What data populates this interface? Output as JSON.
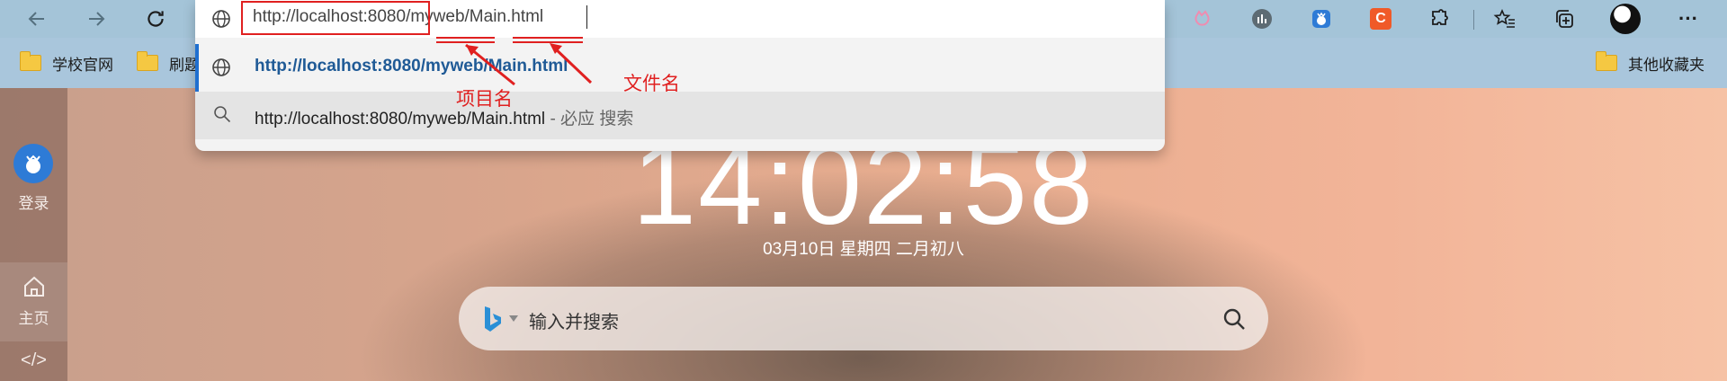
{
  "toolbar": {
    "back_icon": "arrow-left-icon",
    "forward_icon": "arrow-right-icon",
    "refresh_icon": "refresh-icon",
    "extension_icons": [
      "pink-extension-icon",
      "gray-extension-icon",
      "blue-bird-icon",
      "c-extension-icon",
      "puzzle-icon",
      "favorites-icon",
      "collections-icon",
      "profile-avatar",
      "more-icon"
    ],
    "c_extension_letter": "C",
    "more_label": "···"
  },
  "address_bar": {
    "url": "http://localhost:8080/myweb/Main.html"
  },
  "suggestions": [
    {
      "type": "url",
      "text": "http://localhost:8080/myweb/Main.html"
    },
    {
      "type": "search",
      "text": "http://localhost:8080/myweb/Main.html",
      "suffix": " - 必应 搜索"
    }
  ],
  "bookmarks": {
    "items": [
      "学校官网",
      "刷题"
    ],
    "other": "其他收藏夹"
  },
  "annotations": {
    "project_name": "项目名",
    "file_name": "文件名"
  },
  "page": {
    "time": "14:02:58",
    "date": "03月10日 星期四 二月初八",
    "search_placeholder": "输入并搜索",
    "login_label": "登录",
    "home_label": "主页",
    "code_label": "</>"
  },
  "colors": {
    "annotation_red": "#e02020",
    "suggestion_blue": "#1f5a96",
    "c_extension_orange": "#f05a28"
  }
}
